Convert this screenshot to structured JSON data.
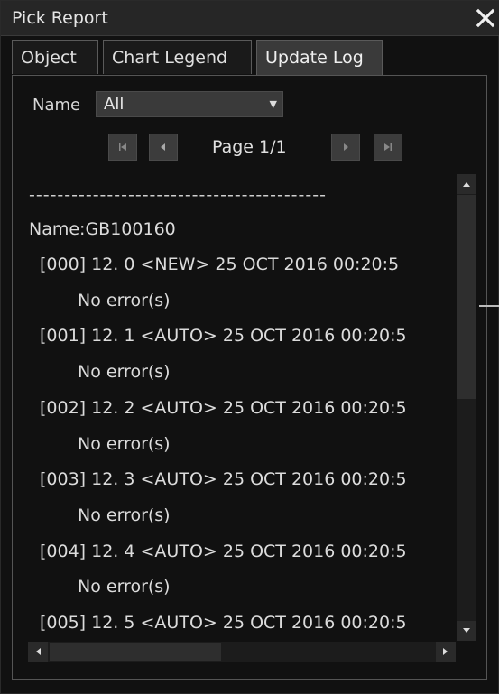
{
  "window": {
    "title": "Pick Report"
  },
  "tabs": [
    {
      "label": "Object",
      "active": false
    },
    {
      "label": "Chart Legend",
      "active": false
    },
    {
      "label": "Update Log",
      "active": true
    }
  ],
  "filter": {
    "label": "Name",
    "value": "All"
  },
  "pagination": {
    "page_text": "Page 1/1"
  },
  "log": {
    "separator": "------------------------------------------",
    "name_line": "Name:GB100160",
    "entries": [
      {
        "text": "[000] 12. 0 <NEW>  25 OCT 2016 00:20:5",
        "status": "No error(s)"
      },
      {
        "text": "[001] 12. 1 <AUTO> 25 OCT 2016 00:20:5",
        "status": "No error(s)"
      },
      {
        "text": "[002] 12. 2 <AUTO> 25 OCT 2016 00:20:5",
        "status": "No error(s)"
      },
      {
        "text": "[003] 12. 3 <AUTO> 25 OCT 2016 00:20:5",
        "status": "No error(s)"
      },
      {
        "text": "[004] 12. 4 <AUTO> 25 OCT 2016 00:20:5",
        "status": "No error(s)"
      },
      {
        "text": "[005] 12. 5 <AUTO> 25 OCT 2016 00:20:5"
      }
    ]
  },
  "colors": {
    "background": "#111111",
    "tab_active": "#3a3a3a",
    "text": "#dcdcdc"
  }
}
